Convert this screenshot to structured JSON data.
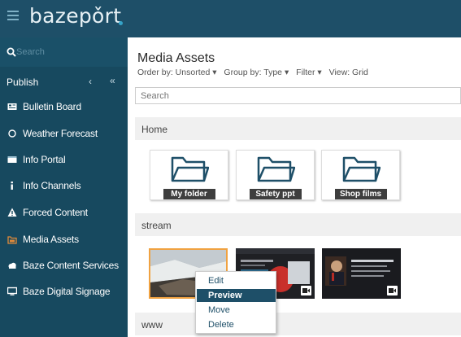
{
  "header": {
    "logo_text": "bazepǒrt",
    "menu_icon": "hamburger-icon"
  },
  "sidebar": {
    "search_placeholder": "Search",
    "publish_label": "Publish",
    "collapse_chevron": "‹",
    "collapse_double": "«",
    "items": [
      {
        "label": "Bulletin Board",
        "icon": "bulletin-board-icon"
      },
      {
        "label": "Weather Forecast",
        "icon": "weather-icon"
      },
      {
        "label": "Info Portal",
        "icon": "info-portal-icon"
      },
      {
        "label": "Info Channels",
        "icon": "info-icon"
      },
      {
        "label": "Forced Content",
        "icon": "warning-icon"
      },
      {
        "label": "Media Assets",
        "icon": "media-assets-icon"
      },
      {
        "label": "Baze Content Services",
        "icon": "cloud-icon"
      },
      {
        "label": "Baze Digital Signage",
        "icon": "monitor-icon"
      }
    ]
  },
  "main": {
    "title": "Media Assets",
    "toolbar": {
      "order_by": "Order by: Unsorted",
      "group_by": "Group by: Type",
      "filter": "Filter",
      "view": "View: Grid",
      "caret": "▾"
    },
    "search_placeholder": "Search",
    "sections": [
      {
        "label": "Home"
      },
      {
        "label": "stream"
      },
      {
        "label": "www"
      }
    ],
    "folders": [
      {
        "label": "My folder"
      },
      {
        "label": "Safety ppt"
      },
      {
        "label": "Shop films"
      }
    ],
    "context_menu": [
      {
        "label": "Edit"
      },
      {
        "label": "Preview"
      },
      {
        "label": "Move"
      },
      {
        "label": "Delete"
      }
    ]
  },
  "colors": {
    "header_bg": "#1e4f68",
    "sidebar_bg": "#17495f",
    "selected_border": "#f0a241",
    "menu_highlight": "#1e4f68"
  }
}
